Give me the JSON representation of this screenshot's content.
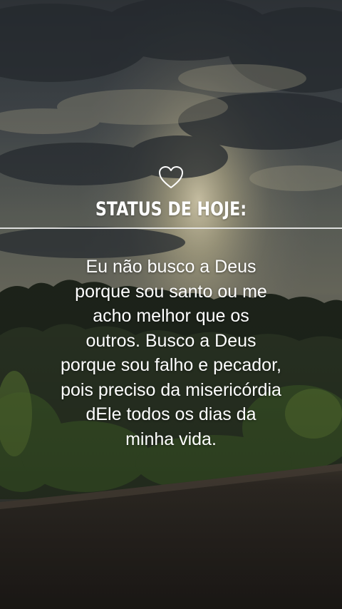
{
  "status": {
    "heading": "STATUS DE HOJE:",
    "icon": "heart-outline-icon",
    "quote_lines": [
      "Eu não busco a Deus",
      "porque sou santo ou me",
      "acho melhor que os",
      "outros. Busco a Deus",
      "porque sou falho e pecador,",
      "pois preciso da misericórdia",
      "dEle todos os dias da",
      "minha vida."
    ]
  },
  "colors": {
    "text": "#ffffff",
    "divider": "#ebebeb"
  }
}
